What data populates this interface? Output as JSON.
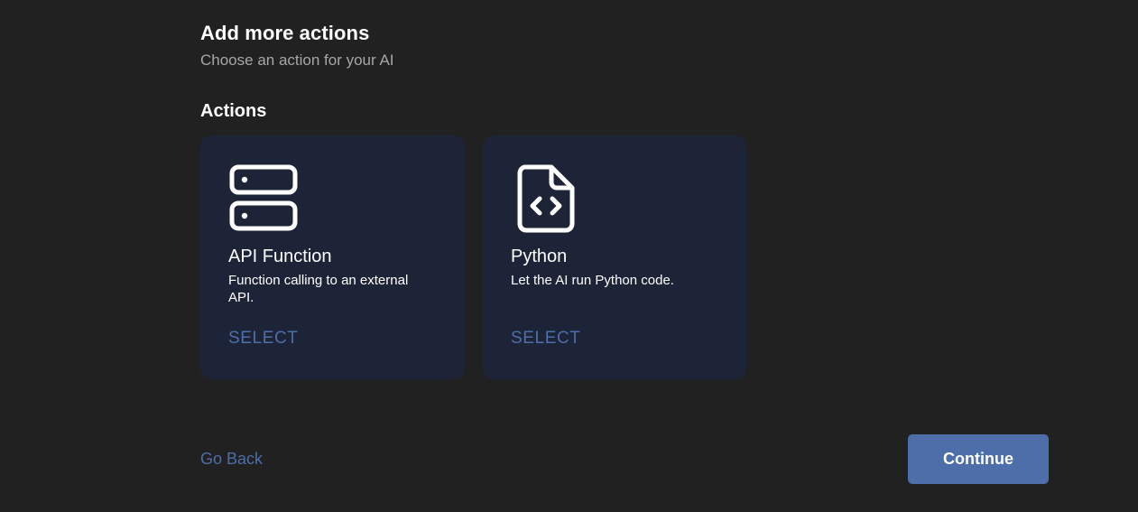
{
  "header": {
    "title": "Add more actions",
    "subtitle": "Choose an action for your AI"
  },
  "actions": {
    "section_label": "Actions",
    "items": [
      {
        "title": "API Function",
        "description": "Function calling to an external API.",
        "select_label": "SELECT",
        "icon": "server-icon"
      },
      {
        "title": "Python",
        "description": "Let the AI run Python code.",
        "select_label": "SELECT",
        "icon": "file-code-icon"
      }
    ]
  },
  "footer": {
    "back_label": "Go Back",
    "continue_label": "Continue"
  },
  "colors": {
    "background": "#212121",
    "card": "#1e2437",
    "accent": "#4d6ea8",
    "muted_text": "#a7a7a7"
  }
}
